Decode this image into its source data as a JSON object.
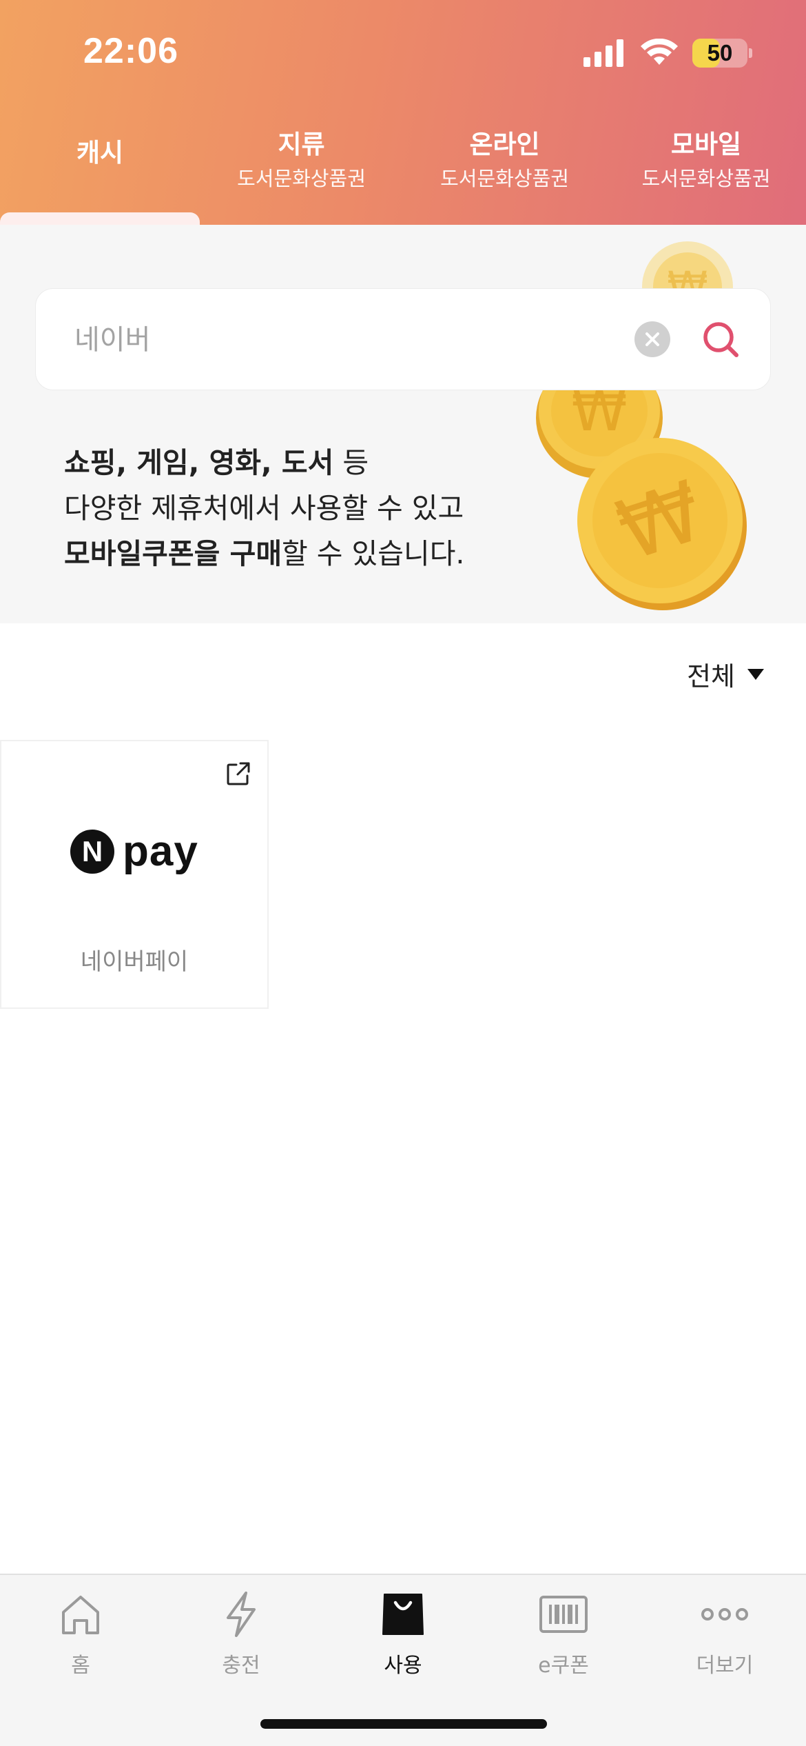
{
  "status_bar": {
    "time": "22:06",
    "battery": "50",
    "battery_level": 0.5
  },
  "tabs": [
    {
      "title": "캐시",
      "subtitle": ""
    },
    {
      "title": "지류",
      "subtitle": "도서문화상품권"
    },
    {
      "title": "온라인",
      "subtitle": "도서문화상품권"
    },
    {
      "title": "모바일",
      "subtitle": "도서문화상품권"
    }
  ],
  "search": {
    "value": "",
    "placeholder": "네이버"
  },
  "banner": {
    "line1_bold": "쇼핑, 게임, 영화, 도서",
    "line1_rest": " 등",
    "line2": "다양한 제휴처에서 사용할 수 있고",
    "line3_bold": "모바일쿠폰을 구매",
    "line3_rest": "할 수 있습니다."
  },
  "filter": {
    "label": "전체"
  },
  "merchants": [
    {
      "logo_n": "N",
      "logo_text": "pay",
      "label": "네이버페이"
    }
  ],
  "bottom_nav": [
    {
      "label": "홈",
      "icon": "home-icon"
    },
    {
      "label": "충전",
      "icon": "lightning-icon"
    },
    {
      "label": "사용",
      "icon": "shopping-bag-icon",
      "active": true
    },
    {
      "label": "e쿠폰",
      "icon": "barcode-icon"
    },
    {
      "label": "더보기",
      "icon": "more-dots-icon"
    }
  ],
  "colors": {
    "gradient_start": "#f2a261",
    "gradient_end": "#e06d7a",
    "accent": "#e0506e",
    "coin": "#f5c542"
  }
}
